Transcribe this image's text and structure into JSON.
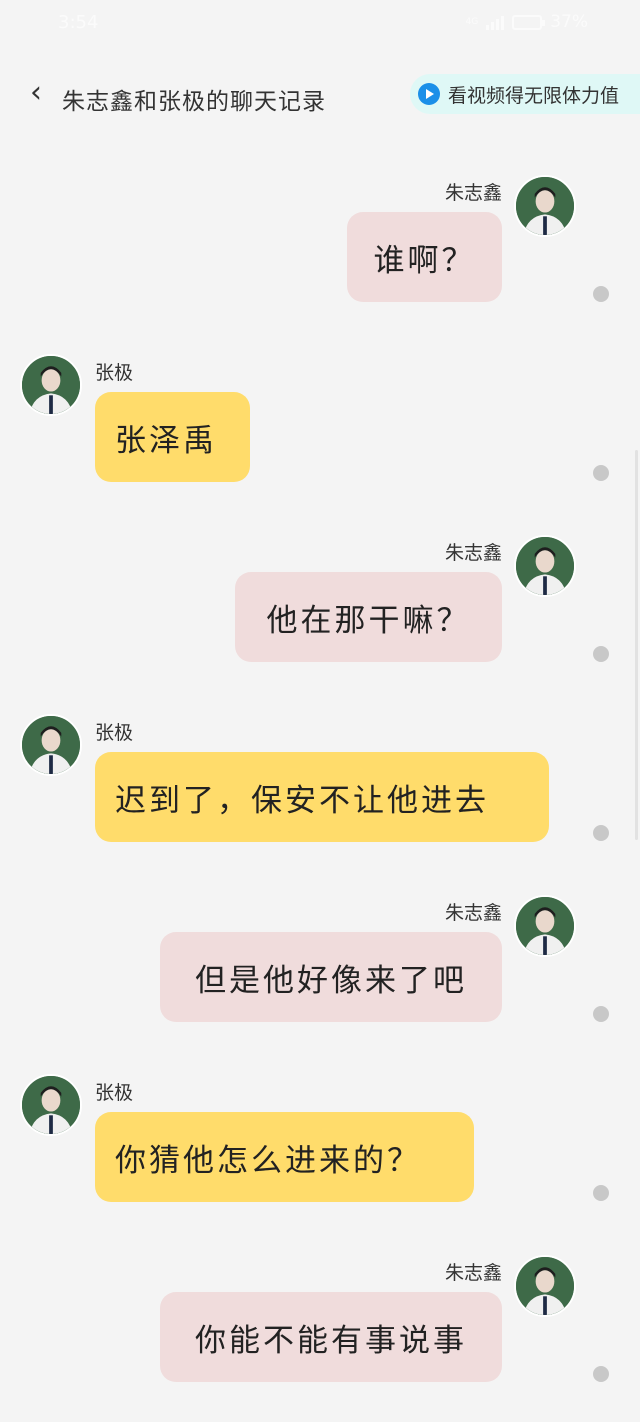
{
  "status_bar": {
    "time": "3:54",
    "network": "4G",
    "battery": "37%"
  },
  "header": {
    "title": "朱志鑫和张极的聊天记录",
    "video_promo": "看视频得无限体力值"
  },
  "messages": [
    {
      "side": "right",
      "sender": "朱志鑫",
      "text": "谁啊？"
    },
    {
      "side": "left",
      "sender": "张极",
      "text": "张泽禹"
    },
    {
      "side": "right",
      "sender": "朱志鑫",
      "text": "他在那干嘛？"
    },
    {
      "side": "left",
      "sender": "张极",
      "text": "迟到了，保安不让他进去"
    },
    {
      "side": "right",
      "sender": "朱志鑫",
      "text": "但是他好像来了吧"
    },
    {
      "side": "left",
      "sender": "张极",
      "text": "你猜他怎么进来的？"
    },
    {
      "side": "right",
      "sender": "朱志鑫",
      "text": "你能不能有事说事"
    }
  ]
}
